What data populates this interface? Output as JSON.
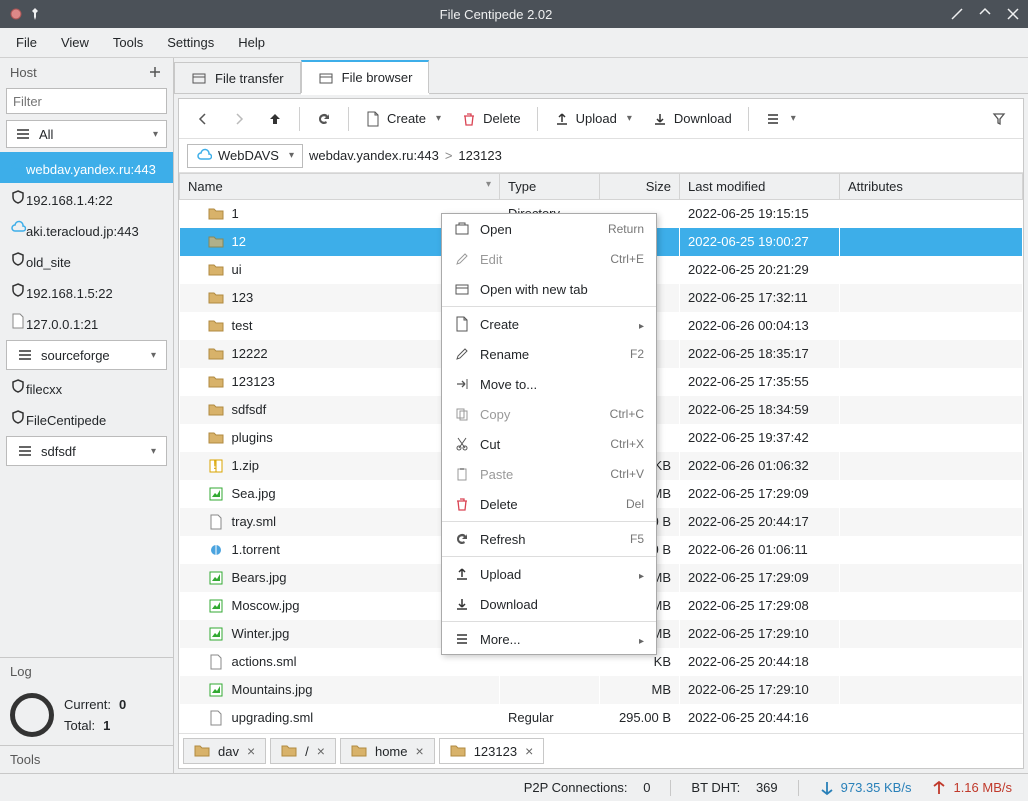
{
  "window": {
    "title": "File Centipede 2.02"
  },
  "menubar": [
    "File",
    "View",
    "Tools",
    "Settings",
    "Help"
  ],
  "sidebar": {
    "header": "Host",
    "filter_placeholder": "Filter",
    "all_label": "All",
    "hosts": [
      {
        "label": "webdav.yandex.ru:443",
        "icon": "cloud",
        "selected": true
      },
      {
        "label": "192.168.1.4:22",
        "icon": "shield"
      },
      {
        "label": "aki.teracloud.jp:443",
        "icon": "cloud"
      },
      {
        "label": "old_site",
        "icon": "shield"
      },
      {
        "label": "192.168.1.5:22",
        "icon": "shield"
      },
      {
        "label": "127.0.0.1:21",
        "icon": "file"
      },
      {
        "label": "sourceforge",
        "icon": "group",
        "group": true
      },
      {
        "label": "filecxx",
        "icon": "shield"
      },
      {
        "label": "FileCentipede",
        "icon": "shield"
      },
      {
        "label": "sdfsdf",
        "icon": "group",
        "group": true
      }
    ],
    "log_label": "Log",
    "stats": {
      "current_label": "Current:",
      "current_value": "0",
      "total_label": "Total:",
      "total_value": "1"
    },
    "tools_label": "Tools"
  },
  "tabs_top": [
    {
      "label": "File transfer",
      "active": false
    },
    {
      "label": "File browser",
      "active": true
    }
  ],
  "toolbar": {
    "create": "Create",
    "delete": "Delete",
    "upload": "Upload",
    "download": "Download"
  },
  "breadcrumb": {
    "protocol": "WebDAVS",
    "parts": [
      "webdav.yandex.ru:443",
      ">",
      "123123"
    ]
  },
  "columns": {
    "name": "Name",
    "type": "Type",
    "size": "Size",
    "modified": "Last modified",
    "attributes": "Attributes"
  },
  "rows": [
    {
      "name": "1",
      "icon": "folder",
      "type": "Directory",
      "size": "",
      "modified": "2022-06-25 19:15:15"
    },
    {
      "name": "12",
      "icon": "folder",
      "type": "",
      "size": "",
      "modified": "2022-06-25 19:00:27",
      "selected": true
    },
    {
      "name": "ui",
      "icon": "folder",
      "type": "",
      "size": "",
      "modified": "2022-06-25 20:21:29"
    },
    {
      "name": "123",
      "icon": "folder",
      "type": "",
      "size": "",
      "modified": "2022-06-25 17:32:11"
    },
    {
      "name": "test",
      "icon": "folder",
      "type": "",
      "size": "",
      "modified": "2022-06-26 00:04:13"
    },
    {
      "name": "12222",
      "icon": "folder",
      "type": "",
      "size": "",
      "modified": "2022-06-25 18:35:17"
    },
    {
      "name": "123123",
      "icon": "folder",
      "type": "",
      "size": "",
      "modified": "2022-06-25 17:35:55"
    },
    {
      "name": "sdfsdf",
      "icon": "folder",
      "type": "",
      "size": "",
      "modified": "2022-06-25 18:34:59"
    },
    {
      "name": "plugins",
      "icon": "folder",
      "type": "",
      "size": "",
      "modified": "2022-06-25 19:37:42"
    },
    {
      "name": "1.zip",
      "icon": "zip",
      "type": "",
      "size": "KB",
      "modified": "2022-06-26 01:06:32"
    },
    {
      "name": "Sea.jpg",
      "icon": "image",
      "type": "",
      "size": "MB",
      "modified": "2022-06-25 17:29:09"
    },
    {
      "name": "tray.sml",
      "icon": "file",
      "type": "",
      "size": "0 B",
      "modified": "2022-06-25 20:44:17"
    },
    {
      "name": "1.torrent",
      "icon": "torrent",
      "type": "",
      "size": "0 B",
      "modified": "2022-06-26 01:06:11"
    },
    {
      "name": "Bears.jpg",
      "icon": "image",
      "type": "",
      "size": "MB",
      "modified": "2022-06-25 17:29:09"
    },
    {
      "name": "Moscow.jpg",
      "icon": "image",
      "type": "",
      "size": "MB",
      "modified": "2022-06-25 17:29:08"
    },
    {
      "name": "Winter.jpg",
      "icon": "image",
      "type": "",
      "size": "MB",
      "modified": "2022-06-25 17:29:10"
    },
    {
      "name": "actions.sml",
      "icon": "file",
      "type": "",
      "size": "KB",
      "modified": "2022-06-25 20:44:18"
    },
    {
      "name": "Mountains.jpg",
      "icon": "image",
      "type": "",
      "size": "MB",
      "modified": "2022-06-25 17:29:10"
    },
    {
      "name": "upgrading.sml",
      "icon": "file",
      "type": "Regular",
      "size": "295.00 B",
      "modified": "2022-06-25 20:44:16"
    }
  ],
  "context_menu": [
    {
      "label": "Open",
      "shortcut": "Return",
      "icon": "open"
    },
    {
      "label": "Edit",
      "shortcut": "Ctrl+E",
      "icon": "edit",
      "disabled": true
    },
    {
      "label": "Open with new tab",
      "icon": "tab"
    },
    {
      "sep": true
    },
    {
      "label": "Create",
      "icon": "create",
      "submenu": true
    },
    {
      "label": "Rename",
      "shortcut": "F2",
      "icon": "rename"
    },
    {
      "label": "Move to...",
      "icon": "move"
    },
    {
      "label": "Copy",
      "shortcut": "Ctrl+C",
      "icon": "copy",
      "disabled": true
    },
    {
      "label": "Cut",
      "shortcut": "Ctrl+X",
      "icon": "cut"
    },
    {
      "label": "Paste",
      "shortcut": "Ctrl+V",
      "icon": "paste",
      "disabled": true
    },
    {
      "label": "Delete",
      "shortcut": "Del",
      "icon": "delete"
    },
    {
      "sep": true
    },
    {
      "label": "Refresh",
      "shortcut": "F5",
      "icon": "refresh"
    },
    {
      "sep": true
    },
    {
      "label": "Upload",
      "icon": "upload",
      "submenu": true
    },
    {
      "label": "Download",
      "icon": "download"
    },
    {
      "sep": true
    },
    {
      "label": "More...",
      "icon": "more",
      "submenu": true
    }
  ],
  "tabs_bottom": [
    {
      "label": "dav",
      "active": false
    },
    {
      "label": "/",
      "active": false
    },
    {
      "label": "home",
      "active": false
    },
    {
      "label": "123123",
      "active": true
    }
  ],
  "statusbar": {
    "p2p_label": "P2P Connections:",
    "p2p_value": "0",
    "dht_label": "BT DHT:",
    "dht_value": "369",
    "down_speed": "973.35 KB/s",
    "up_speed": "1.16 MB/s"
  },
  "colors": {
    "accent": "#3daee9",
    "down": "#2980b9",
    "up": "#c0392b"
  }
}
